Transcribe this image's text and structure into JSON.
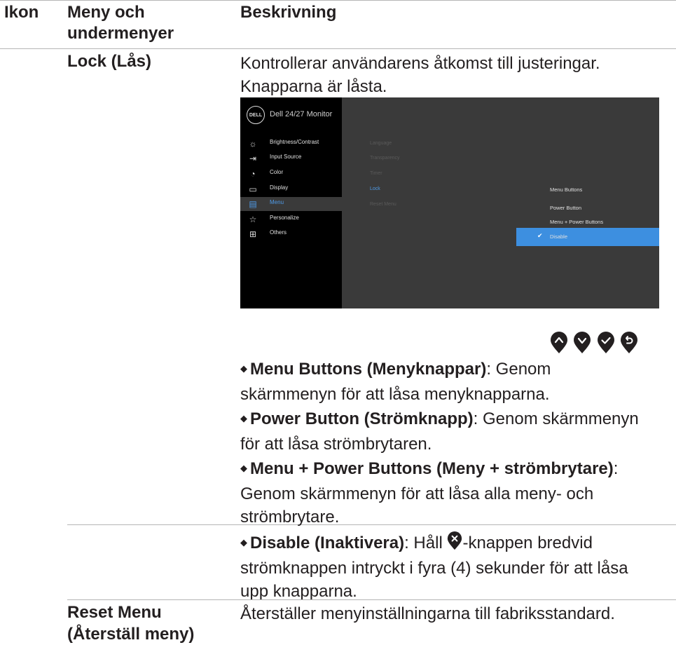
{
  "header": {
    "col_icon": "Ikon",
    "col_menu_line1": "Meny och",
    "col_menu_line2": "undermenyer",
    "col_desc": "Beskrivning"
  },
  "lock_row": {
    "name": "Lock (Lås)",
    "desc_line1": "Kontrollerar användarens åtkomst till justeringar.",
    "desc_line2": "Knapparna är låsta."
  },
  "osd": {
    "logo": "DELL",
    "title": "Dell 24/27 Monitor",
    "menu": [
      {
        "label": "Brightness/Contrast",
        "icon": "brightness-icon"
      },
      {
        "label": "Input Source",
        "icon": "input-source-icon"
      },
      {
        "label": "Color",
        "icon": "color-icon"
      },
      {
        "label": "Display",
        "icon": "display-icon"
      },
      {
        "label": "Menu",
        "icon": "menu-icon",
        "active": true
      },
      {
        "label": "Personalize",
        "icon": "star-icon"
      },
      {
        "label": "Others",
        "icon": "others-icon"
      }
    ],
    "submenu": [
      "Language",
      "Transparency",
      "Timer",
      "Lock",
      "Reset Menu"
    ],
    "submenu_active": "Lock",
    "options": [
      "Menu Buttons",
      "Power Button",
      "Menu + Power Buttons",
      "Disable"
    ],
    "option_selected": "Disable",
    "accent_color": "#3d8fe0"
  },
  "joystick_buttons": [
    "up-button-icon",
    "down-button-icon",
    "check-button-icon",
    "back-button-icon"
  ],
  "bullets": [
    {
      "bold": "Menu Buttons (Menyknappar)",
      "text1": ": Genom",
      "text2": "skärmmenyn för att låsa menyknapparna."
    },
    {
      "bold": "Power Button (Strömknapp)",
      "text1": ": Genom skärmmenyn",
      "text2": "för att låsa strömbrytaren."
    },
    {
      "bold": "Menu + Power Buttons (Meny + strömbrytare)",
      "text1": ":",
      "text2": "Genom skärmmenyn för att låsa alla meny- och",
      "text3": "strömbrytare."
    },
    {
      "bold": "Disable (Inaktivera)",
      "text1": ": Håll ",
      "text1b": "-knappen bredvid",
      "text2": "strömknappen intryckt i fyra (4) sekunder för att låsa",
      "text3": "upp knapparna."
    }
  ],
  "reset_row": {
    "name_line1": "Reset Menu",
    "name_line2": "(Återställ meny)",
    "desc": "Återställer menyinställningarna till fabriksstandard."
  }
}
